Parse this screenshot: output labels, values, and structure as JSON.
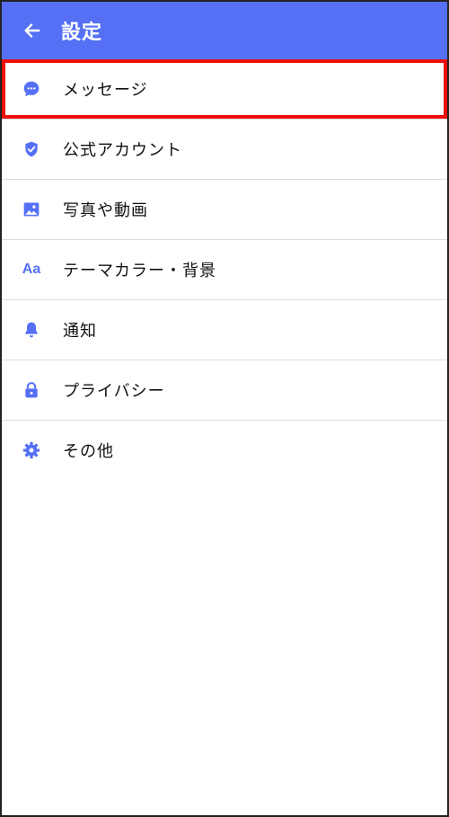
{
  "header": {
    "title": "設定",
    "accent_color": "#5570f5",
    "back_icon": "arrow-left-icon"
  },
  "settings": {
    "items": [
      {
        "label": "メッセージ",
        "icon": "chat-bubble-icon",
        "highlighted": true
      },
      {
        "label": "公式アカウント",
        "icon": "shield-check-icon"
      },
      {
        "label": "写真や動画",
        "icon": "image-icon"
      },
      {
        "label": "テーマカラー・背景",
        "icon": "font-aa-icon",
        "icon_text": "Aa"
      },
      {
        "label": "通知",
        "icon": "bell-icon"
      },
      {
        "label": "プライバシー",
        "icon": "lock-icon"
      },
      {
        "label": "その他",
        "icon": "gear-icon"
      }
    ],
    "highlight_color": "#ee0d0d"
  }
}
